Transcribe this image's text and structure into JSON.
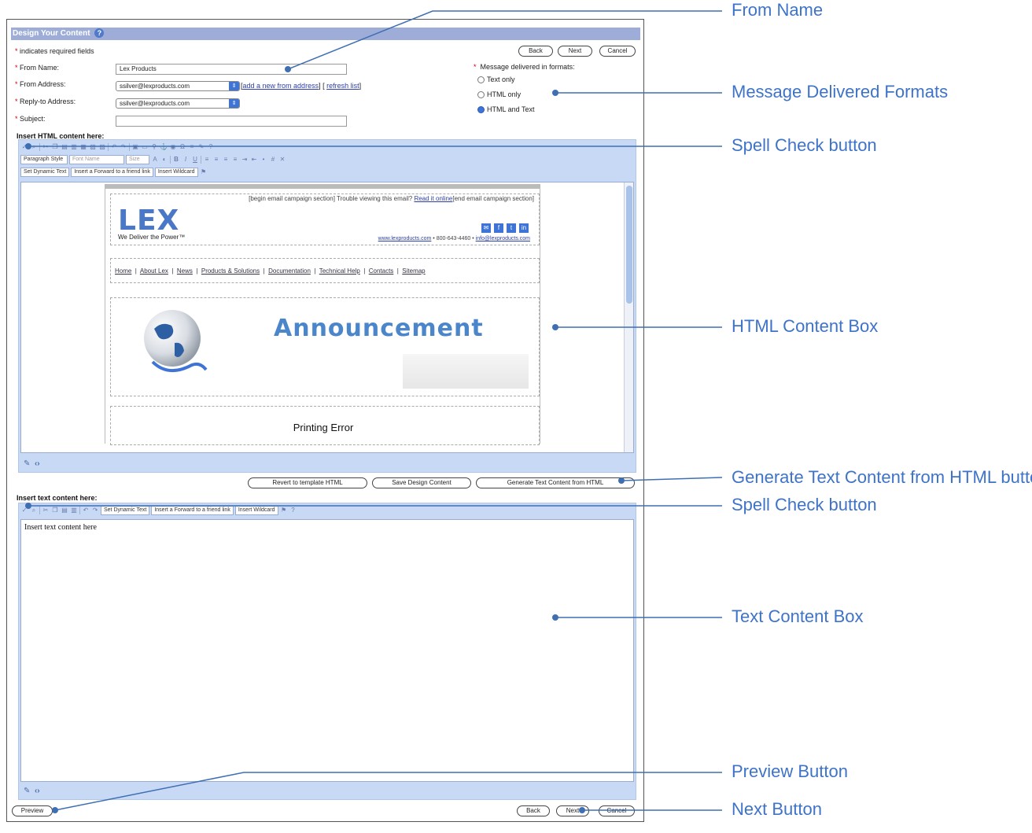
{
  "page": {
    "title": "Design Your Content",
    "required_note": "indicates required fields",
    "from_name_label": "From Name:",
    "from_name_value": "Lex Products",
    "from_address_label": "From Address:",
    "from_address_value": "ssilver@lexproducts.com",
    "add_from_link": "add a new from address",
    "refresh_link": "refresh list",
    "reply_to_label": "Reply-to Address:",
    "reply_to_value": "ssilver@lexproducts.com",
    "subject_label": "Subject:",
    "subject_value": ""
  },
  "top_buttons": {
    "back": "Back",
    "next": "Next",
    "cancel": "Cancel"
  },
  "formats": {
    "label": "Message delivered in formats:",
    "options": [
      "Text only",
      "HTML only",
      "HTML and Text"
    ],
    "selected": "HTML and Text"
  },
  "html_editor": {
    "label": "Insert HTML content here:",
    "paragraph_style": "Paragraph Style",
    "font_name": "Font Name",
    "size": "Size",
    "dynamic_text": "Set Dynamic Text",
    "forward_link": "Insert a Forward to a friend link",
    "wildcard": "Insert Wildcard"
  },
  "email_preview": {
    "header_text": "[begin email campaign section] Trouble viewing this email? ",
    "read_online": "Read it online",
    "header_text_end": "[end email campaign section]",
    "logo": "LEX",
    "tagline": "We Deliver the Power™",
    "website": "www.lexproducts.com",
    "phone": " • 800-643-4460 • ",
    "email": "info@lexproducts.com",
    "nav": [
      "Home",
      "About Lex",
      "News",
      "Products & Solutions",
      "Documentation",
      "Technical Help",
      "Contacts",
      "Sitemap"
    ],
    "banner": "Announcement",
    "error_text": "Printing Error"
  },
  "action_buttons": {
    "revert": "Revert to template HTML",
    "save": "Save Design Content",
    "generate": "Generate Text Content from HTML"
  },
  "text_editor": {
    "label": "Insert text content here:",
    "dynamic_text": "Set Dynamic Text",
    "forward_link": "Insert a Forward to a friend link",
    "wildcard": "Insert Wildcard",
    "placeholder_text": "Insert text content here"
  },
  "bottom_buttons": {
    "preview": "Preview",
    "back": "Back",
    "next": "Next",
    "cancel": "Cancel"
  },
  "callouts": {
    "from_name": "From Name",
    "formats": "Message Delivered Formats",
    "spell_check_1": "Spell Check button",
    "html_box": "HTML Content Box",
    "generate": "Generate Text Content from HTML button",
    "spell_check_2": "Spell Check button",
    "text_box": "Text Content Box",
    "preview": "Preview Button",
    "next": "Next Button"
  },
  "colors": {
    "title_bar": "#9eadd8",
    "editor_bg": "#c8d9f5",
    "callout": "#3e73c8"
  }
}
